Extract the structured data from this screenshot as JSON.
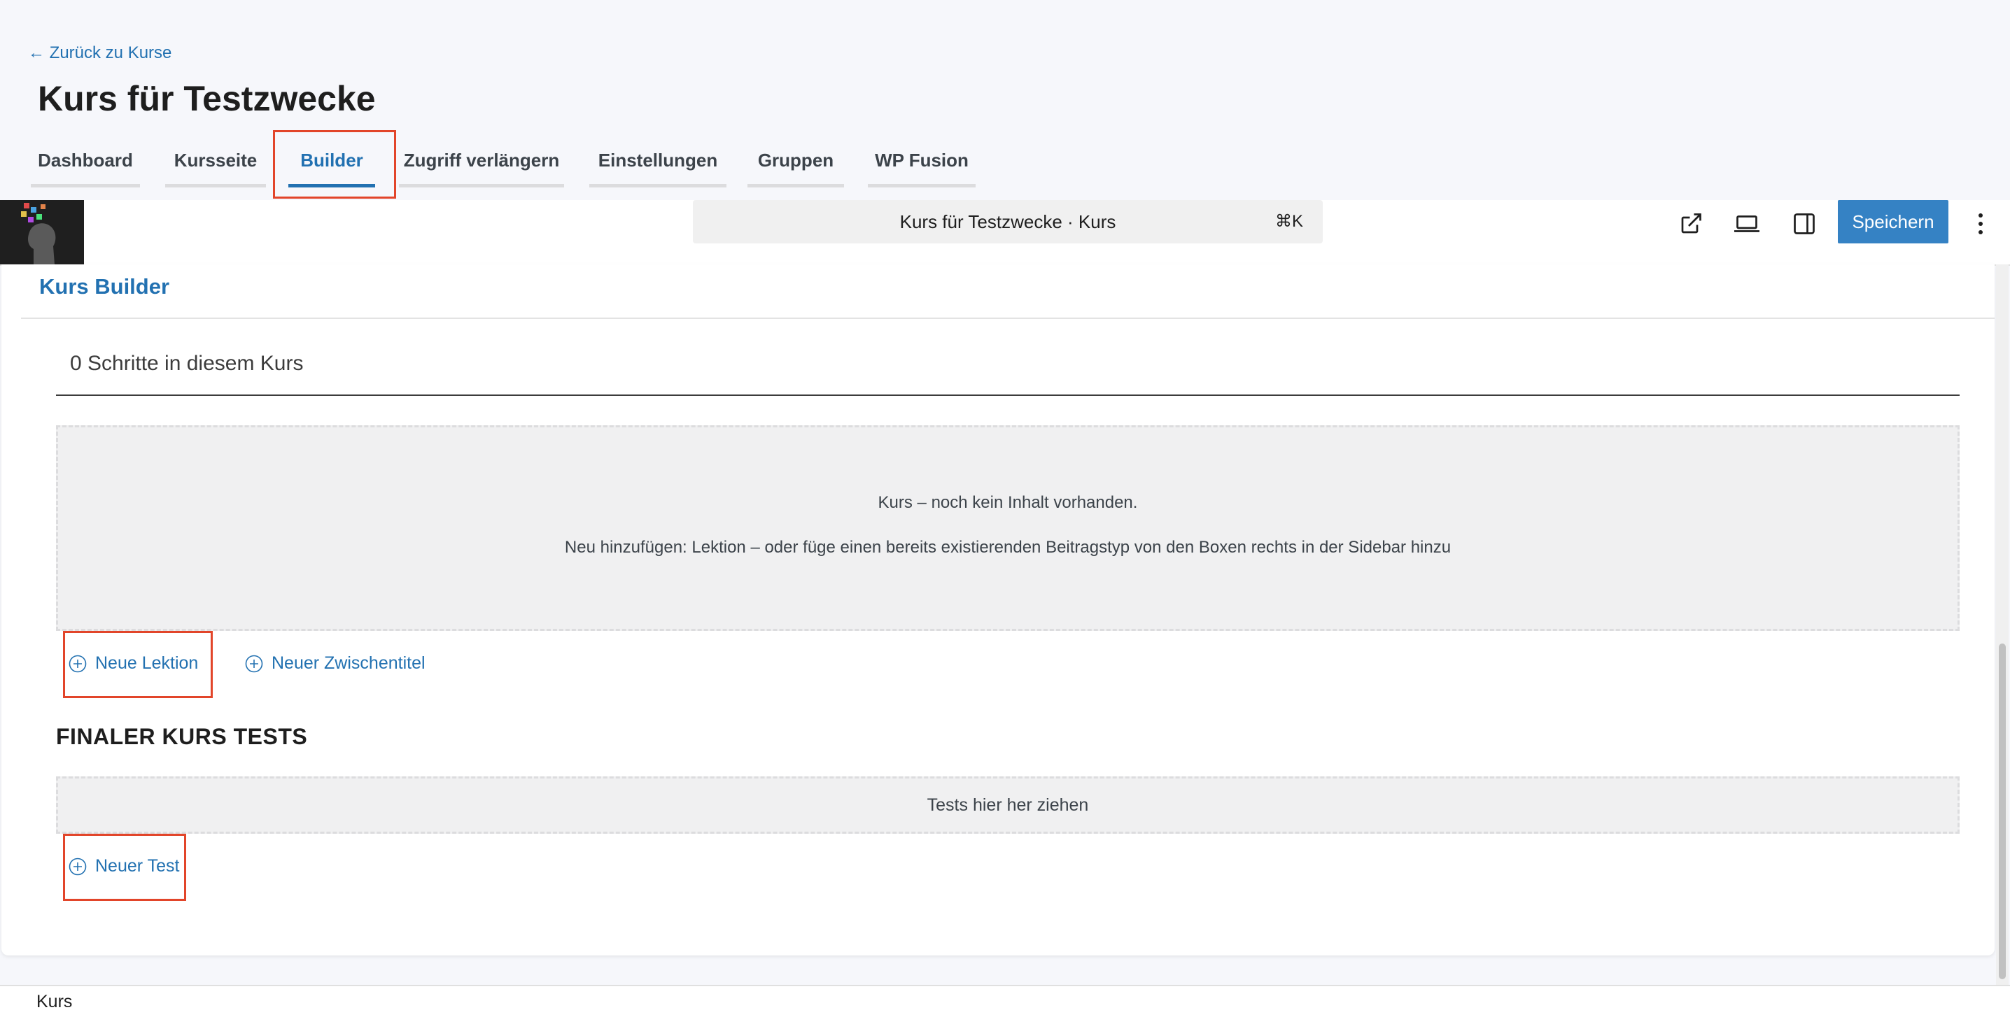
{
  "header": {
    "back_link": "← Zurück zu Kurse",
    "course_title": "Kurs für Testzwecke",
    "tabs": [
      {
        "label": "Dashboard"
      },
      {
        "label": "Kursseite"
      },
      {
        "label": "Builder",
        "active": true
      },
      {
        "label": "Zugriff verlängern"
      },
      {
        "label": "Einstellungen"
      },
      {
        "label": "Gruppen"
      },
      {
        "label": "WP Fusion"
      }
    ]
  },
  "toolbar": {
    "command_bar_text": "Kurs für Testzwecke · Kurs",
    "command_shortcut": "⌘K",
    "save_label": "Speichern",
    "icons": [
      "external-link-icon",
      "laptop-preview-icon",
      "sidebar-toggle-icon",
      "more-vertical-icon"
    ]
  },
  "builder": {
    "heading": "Kurs Builder",
    "steps_count": "0 Schritte in diesem Kurs",
    "empty_line1": "Kurs – noch kein Inhalt vorhanden.",
    "empty_line2": "Neu hinzufügen: Lektion – oder füge einen bereits existierenden Beitragstyp von den Boxen rechts in der Sidebar hinzu",
    "add_lesson": "Neue Lektion",
    "add_section": "Neuer Zwischentitel",
    "final_tests_heading": "FINALER KURS TESTS",
    "tests_dropzone": "Tests hier her ziehen",
    "add_test": "Neuer Test"
  },
  "footer": {
    "breadcrumb": "Kurs"
  },
  "colors": {
    "accent": "#2271b1",
    "save_button": "#3582c4",
    "highlight": "#e2452a",
    "page_bg": "#f6f7fb"
  }
}
